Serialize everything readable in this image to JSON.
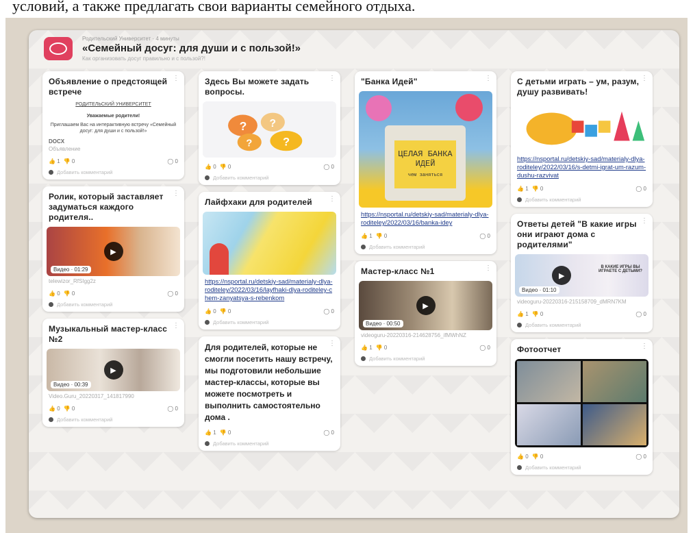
{
  "caption": "условий, а также предлагать свои варианты семейного отдыха.",
  "header": {
    "crumb": "Родительский Университет · 4 минуты",
    "title": "«Семейный досуг: для души и с пользой!»",
    "subtitle": "Как организовать досуг правильно и с пользой?!"
  },
  "cards": {
    "announce": {
      "title": "Объявление о предстоящей встрече",
      "doc_head": "РОДИТЕЛЬСКИЙ УНИВЕРСИТЕТ",
      "doc_greeting": "Уважаемые родители!",
      "doc_body": "Приглашаем Вас на интерактивную встречу «Семейный досуг: для души и с пользой!»",
      "doc_tag": "DOCX",
      "caption": "Объявление",
      "likes": "1",
      "dislikes": "0",
      "comments": "0",
      "add_comment": "Добавить комментарий"
    },
    "video1": {
      "title": "Ролик, который заставляет задуматься каждого родителя..",
      "badge": "Видео · 01:29",
      "caption": "telewizor_RfSIgg2z",
      "likes": "0",
      "dislikes": "0",
      "comments": "0",
      "add_comment": "Добавить комментарий"
    },
    "music": {
      "title": "Музыкальный мастер-класс №2",
      "badge": "Видео · 00:39",
      "caption": "Video.Guru_20220317_141817990",
      "likes": "0",
      "dislikes": "0",
      "comments": "0",
      "add_comment": "Добавить комментарий"
    },
    "questions": {
      "title": "Здесь Вы можете задать вопросы.",
      "likes": "0",
      "dislikes": "0",
      "comments": "0",
      "add_comment": "Добавить комментарий"
    },
    "lifehacks": {
      "title": "Лайфхаки для родителей",
      "link": "https://nsportal.ru/detskiy-sad/materialy-dlya-roditeley/2022/03/16/layfhaki-dlya-roditeley-chem-zanyatsya-s-rebenkom",
      "likes": "0",
      "dislikes": "0",
      "comments": "0",
      "add_comment": "Добавить комментарий"
    },
    "note": {
      "text": "Для родителей, которые не смогли посетить нашу встречу, мы подготовили небольшие мастер-классы, которые вы можете посмотреть и выполнить самостоятельно дома .",
      "likes": "1",
      "dislikes": "0",
      "comments": "0",
      "add_comment": "Добавить комментарий"
    },
    "bank": {
      "title": "\"Банка Идей\"",
      "jar_text": "ЦЕЛАЯ БАНКА ИДЕЙ",
      "jar_sub": "чем заняться",
      "link": "https://nsportal.ru/detskiy-sad/materialy-dlya-roditeley/2022/03/16/banka-idey",
      "likes": "1",
      "dislikes": "0",
      "comments": "0",
      "add_comment": "Добавить комментарий"
    },
    "master1": {
      "title": "Мастер-класс №1",
      "badge": "Видео · 00:50",
      "caption": "videoguru-20220316-214628756_ifMWhNZ",
      "likes": "1",
      "dislikes": "0",
      "comments": "0",
      "add_comment": "Добавить комментарий"
    },
    "play": {
      "title": "С детьми играть – ум, разум, душу развивать!",
      "link": "https://nsportal.ru/detskiy-sad/materialy-dlya-roditeley/2022/03/16/s-detmi-igrat-um-razum-dushu-razvivat",
      "likes": "1",
      "dislikes": "0",
      "comments": "0",
      "add_comment": "Добавить комментарий"
    },
    "answers": {
      "title": "Ответы детей \"В какие игры они играют дома с родителями\"",
      "overlay": "В КАКИЕ ИГРЫ ВЫ ИГРАЕТЕ С ДЕТЬМИ?",
      "badge": "Видео · 01:10",
      "caption": "videoguru-20220316-215158709_dMRN7KM",
      "likes": "1",
      "dislikes": "0",
      "comments": "0",
      "add_comment": "Добавить комментарий"
    },
    "photo": {
      "title": "Фотоотчет",
      "likes": "0",
      "dislikes": "0",
      "comments": "0",
      "add_comment": "Добавить комментарий"
    }
  },
  "colors": {
    "brand": "#e0405e",
    "link": "#1e3a8a"
  }
}
